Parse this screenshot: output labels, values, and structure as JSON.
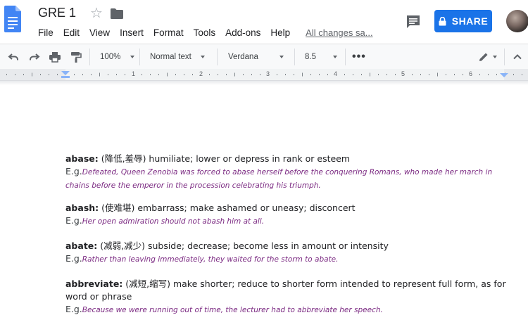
{
  "document": {
    "title": "GRE 1",
    "save_status": "All changes sa..."
  },
  "menu": [
    "File",
    "Edit",
    "View",
    "Insert",
    "Format",
    "Tools",
    "Add-ons",
    "Help"
  ],
  "share": {
    "label": "SHARE"
  },
  "toolbar": {
    "zoom": "100%",
    "style": "Normal text",
    "font": "Verdana",
    "font_size": "8.5",
    "more": "•••"
  },
  "ruler": {
    "numbers": [
      "1",
      "2",
      "3",
      "4",
      "5",
      "6"
    ]
  },
  "entries": [
    {
      "word": "abase:",
      "definition": " (降低,羞辱) humiliate; lower or depress in rank or esteem",
      "eg_prefix": "E.g.",
      "example": "Defeated, Queen Zenobia was forced to abase herself before the conquering Romans, who made her march in chains before the emperor in the procession celebrating his triumph."
    },
    {
      "word": "abash:",
      "definition": " (使难堪) embarrass; make ashamed or uneasy; disconcert",
      "eg_prefix": "E.g.",
      "example": "Her open admiration should not abash him at all."
    },
    {
      "word": "abate:",
      "definition": " (减弱,减少) subside; decrease; become less in amount or intensity",
      "eg_prefix": "E.g.",
      "example": "Rather than leaving immediately, they waited for the storm to abate."
    },
    {
      "word": "abbreviate:",
      "definition": " (减短,缩写) make shorter; reduce to shorter form intended to represent full form, as for word or phrase",
      "eg_prefix": "E.g.",
      "example": "Because we were running out of time, the lecturer had to abbreviate her speech."
    }
  ],
  "colors": {
    "docs_blue": "#4285f4",
    "share_blue": "#1a73e8",
    "example_purple": "#7b2a82"
  }
}
